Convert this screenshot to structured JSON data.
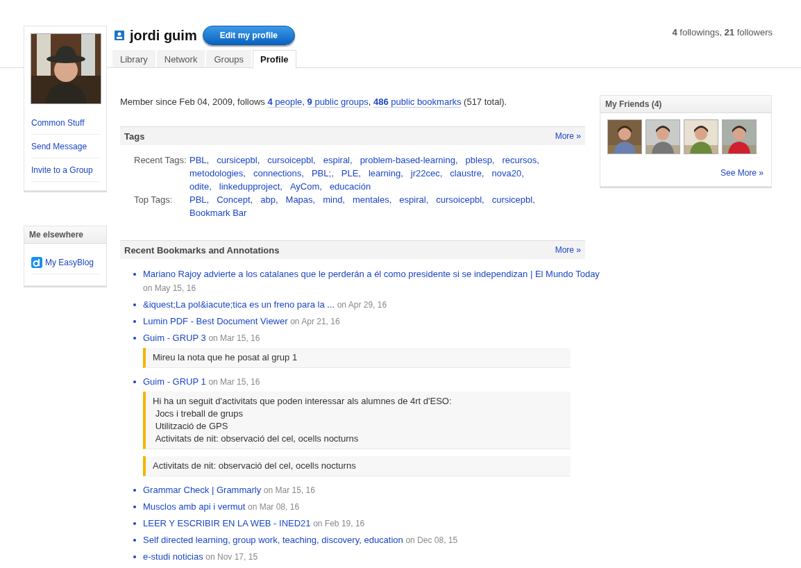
{
  "profile": {
    "name": "jordi guim",
    "edit_button": "Edit my profile",
    "stats": "**4** followings, **21** followers"
  },
  "tabs": [
    {
      "label": "Library",
      "selected": false
    },
    {
      "label": "Network",
      "selected": false
    },
    {
      "label": "Groups",
      "selected": false
    },
    {
      "label": "Profile",
      "selected": true
    }
  ],
  "sidebar": {
    "links": [
      "Common Stuff",
      "Send Message",
      "Invite to a Group"
    ],
    "elsewhere": {
      "title": "Me elsewhere",
      "links": [
        "My EasyBlog"
      ]
    }
  },
  "member_line": [
    {
      "kind": "text",
      "text": "Member since Feb 04, 2009, follows "
    },
    {
      "kind": "link",
      "text": "**4** people"
    },
    {
      "kind": "text",
      "text": ", "
    },
    {
      "kind": "link",
      "text": "**9** public groups"
    },
    {
      "kind": "text",
      "text": ", "
    },
    {
      "kind": "link",
      "text": "**486** public bookmarks"
    },
    {
      "kind": "text",
      "text": " (517 total)."
    }
  ],
  "tags": {
    "title": "Tags",
    "more": "More »",
    "rows": [
      {
        "label": "Recent Tags:",
        "tags": [
          "PBL,",
          "cursicepbl,",
          "cursoicepbl,",
          "espiral,",
          "problem-based-learning,",
          "pblesp,",
          "recursos,",
          "metodologies,",
          "connections,",
          "PBL;,",
          "PLE,",
          "learning,",
          "jr22cec,",
          "claustre,",
          "nova20,",
          "odite,",
          "linkedupproject,",
          "AyCom,",
          "educación"
        ]
      },
      {
        "label": "Top Tags:",
        "tags": [
          "PBL,",
          "Concept,",
          "abp,",
          "Mapas,",
          "mind,",
          "mentales,",
          "espiral,",
          "cursoicepbl,",
          "cursicepbl,",
          "Bookmark Bar"
        ]
      }
    ]
  },
  "bookmarks": {
    "title": "Recent Bookmarks and Annotations",
    "more": "More »",
    "items": [
      {
        "title": "Mariano Rajoy advierte a los catalanes que le perderán a él como presidente si se independizan | El Mundo Today",
        "date": "on May 15, 16"
      },
      {
        "title": "&iquest;La pol&iacute;tica es un freno para la ...",
        "date": "on Apr 29, 16"
      },
      {
        "title": "Lumin PDF - Best Document Viewer",
        "date": "on Apr 21, 16"
      },
      {
        "title": "Guim - GRUP 3",
        "date": "on Mar 15, 16",
        "notes": [
          "Mireu la nota que he posat al grup 1"
        ]
      },
      {
        "title": "Guim - GRUP 1",
        "date": "on Mar 15, 16",
        "notes": [
          "Hi ha un seguit d'activitats que poden interessar als alumnes de 4rt d'ESO:\n Jocs i treball de grups\n Utilització de GPS\n Activitats de nit: observació del cel, ocells nocturns",
          "Activitats de nit: observació del cel, ocells nocturns"
        ]
      },
      {
        "title": "Grammar Check | Grammarly",
        "date": "on Mar 15, 16"
      },
      {
        "title": "Musclos amb api i vermut",
        "date": "on Mar 08, 16"
      },
      {
        "title": "LEER Y ESCRIBIR EN LA WEB - INED21",
        "date": "on Feb 19, 16"
      },
      {
        "title": "Self directed learning, group work, teaching, discovery, education",
        "date": "on Dec 08, 15"
      },
      {
        "title": "e-studi noticias",
        "date": "on Nov 17, 15"
      }
    ]
  },
  "friends": {
    "title": "My Friends (4)",
    "see_more": "See More »"
  }
}
